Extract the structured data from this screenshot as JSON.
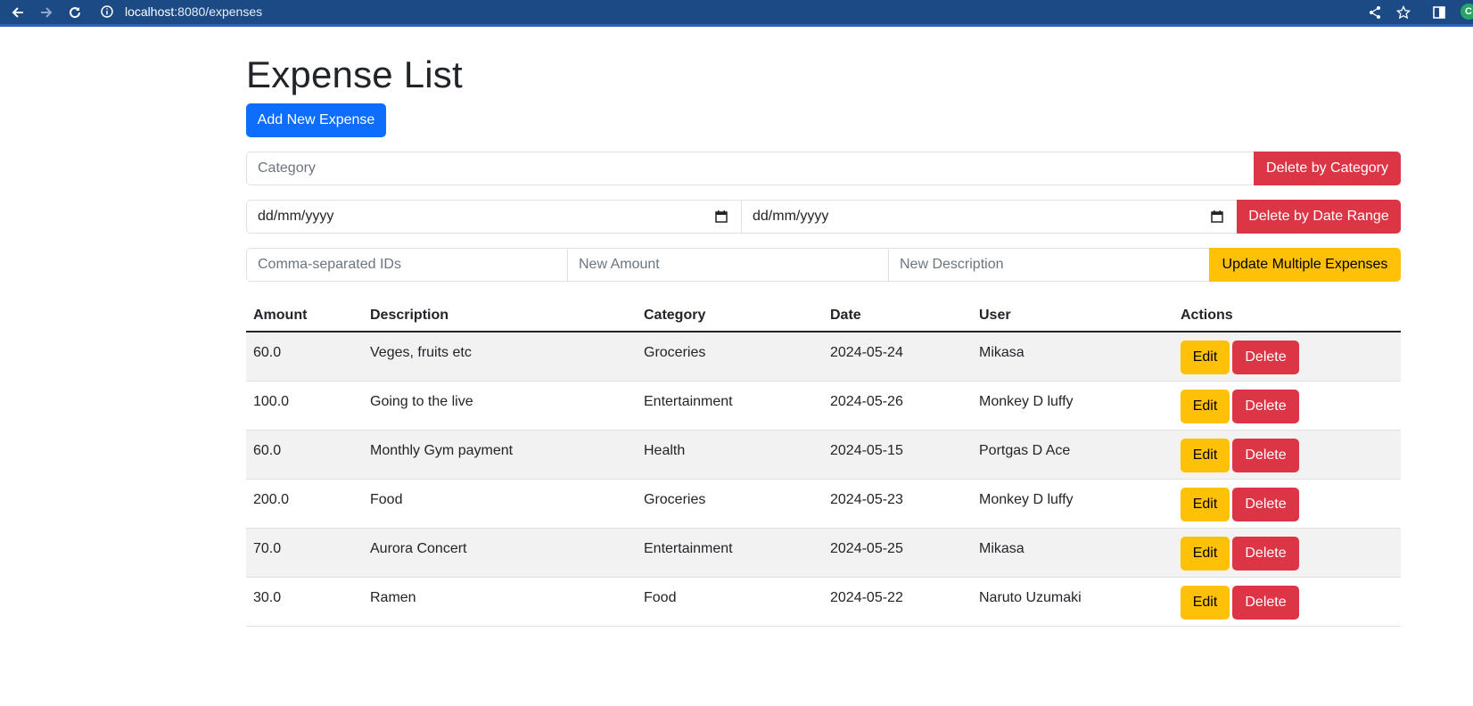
{
  "browser": {
    "url_host": "localhost",
    "url_path": ":8080/expenses",
    "profile_initial": "C"
  },
  "page": {
    "title": "Expense List",
    "add_button": "Add New Expense"
  },
  "filters": {
    "category_placeholder": "Category",
    "delete_category_button": "Delete by Category",
    "start_date_placeholder": "dd/mm/yyyy",
    "end_date_placeholder": "dd/mm/yyyy",
    "delete_date_button": "Delete by Date Range",
    "ids_placeholder": "Comma-separated IDs",
    "amount_placeholder": "New Amount",
    "description_placeholder": "New Description",
    "update_button": "Update Multiple Expenses"
  },
  "table": {
    "headers": [
      "Amount",
      "Description",
      "Category",
      "Date",
      "User",
      "Actions"
    ],
    "edit_label": "Edit",
    "delete_label": "Delete",
    "rows": [
      {
        "amount": "60.0",
        "description": "Veges, fruits etc",
        "category": "Groceries",
        "date": "2024-05-24",
        "user": "Mikasa"
      },
      {
        "amount": "100.0",
        "description": "Going to the live",
        "category": "Entertainment",
        "date": "2024-05-26",
        "user": "Monkey D luffy"
      },
      {
        "amount": "60.0",
        "description": "Monthly Gym payment",
        "category": "Health",
        "date": "2024-05-15",
        "user": "Portgas D Ace"
      },
      {
        "amount": "200.0",
        "description": "Food",
        "category": "Groceries",
        "date": "2024-05-23",
        "user": "Monkey D luffy"
      },
      {
        "amount": "70.0",
        "description": "Aurora Concert",
        "category": "Entertainment",
        "date": "2024-05-25",
        "user": "Mikasa"
      },
      {
        "amount": "30.0",
        "description": "Ramen",
        "category": "Food",
        "date": "2024-05-22",
        "user": "Naruto Uzumaki"
      }
    ]
  },
  "colors": {
    "primary": "#0d6efd",
    "danger": "#dc3545",
    "warning": "#ffc107",
    "chrome": "#1b4a84"
  }
}
